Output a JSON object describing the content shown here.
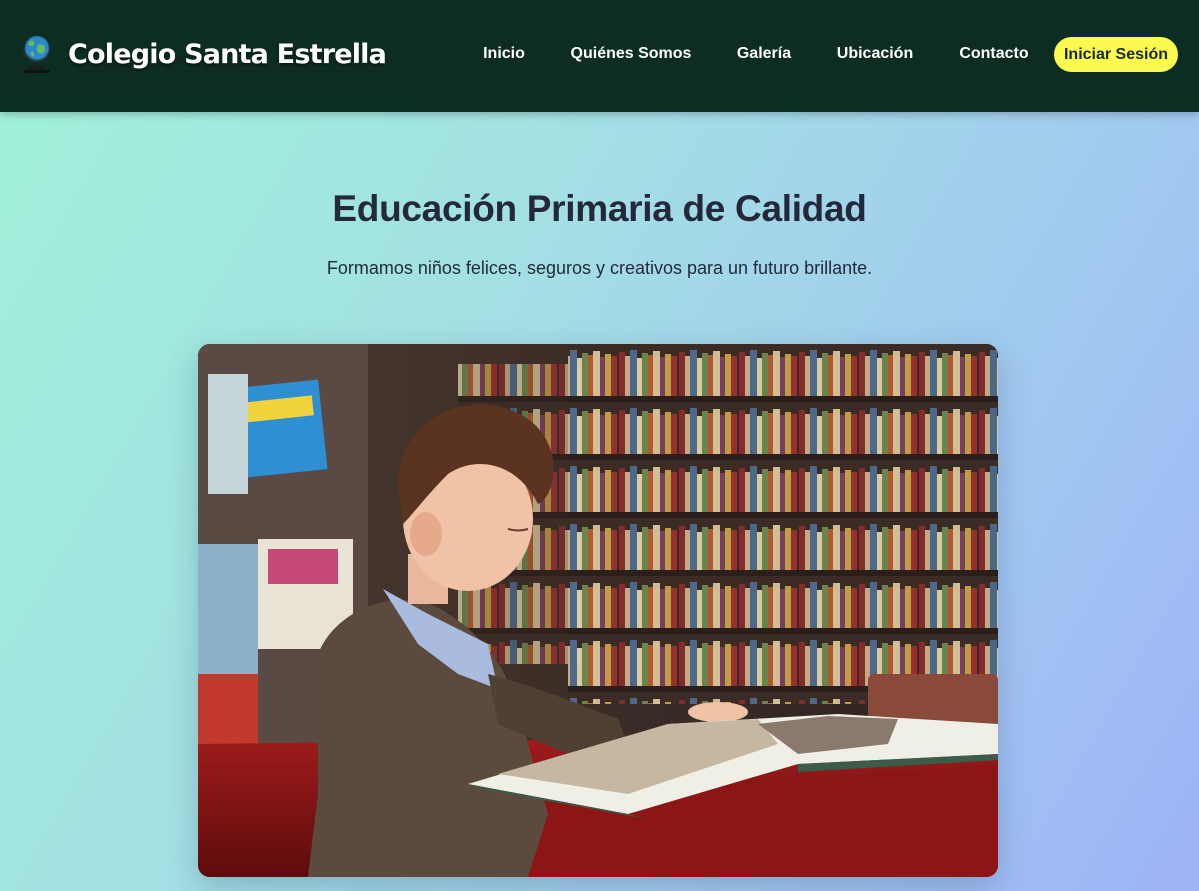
{
  "header": {
    "brand_name": "Colegio Santa Estrella",
    "logo_icon": "globe-icon",
    "nav": [
      {
        "label": "Inicio"
      },
      {
        "label": "Quiénes Somos"
      },
      {
        "label": "Galería"
      },
      {
        "label": "Ubicación"
      },
      {
        "label": "Contacto"
      }
    ],
    "login_label": "Iniciar Sesión"
  },
  "hero": {
    "title": "Educación Primaria de Calidad",
    "subtitle": "Formamos niños felices, seguros y creativos para un futuro brillante."
  },
  "colors": {
    "header_bg": "#0d2d22",
    "accent_button": "#fbfb4f",
    "title_text": "#23283a"
  }
}
